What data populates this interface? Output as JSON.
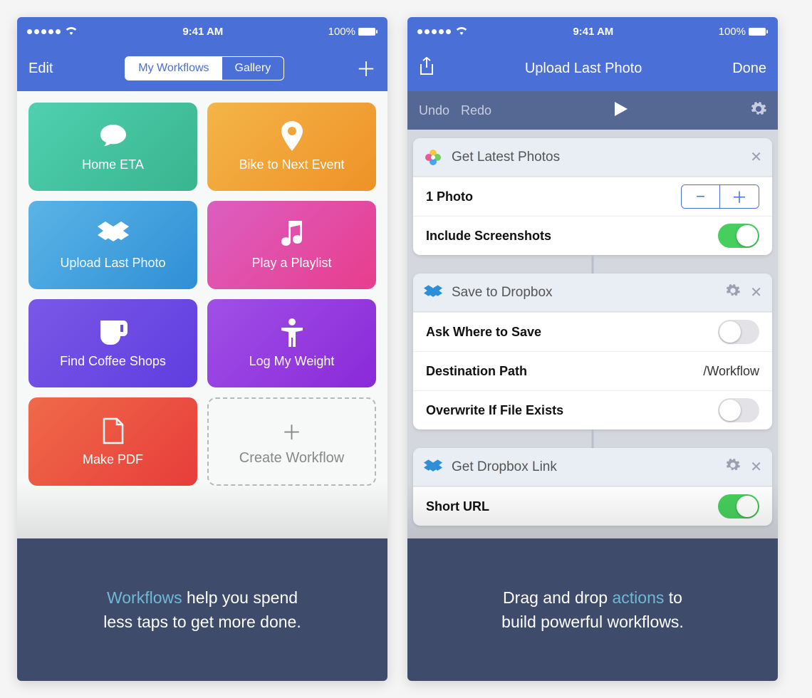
{
  "statusbar": {
    "time": "9:41 AM",
    "battery": "100%"
  },
  "screen1": {
    "nav": {
      "left": "Edit",
      "tabs": [
        "My Workflows",
        "Gallery"
      ],
      "activeTab": 0
    },
    "tiles": [
      {
        "label": "Home ETA"
      },
      {
        "label": "Bike to Next Event"
      },
      {
        "label": "Upload Last Photo"
      },
      {
        "label": "Play a Playlist"
      },
      {
        "label": "Find Coffee Shops"
      },
      {
        "label": "Log My Weight"
      },
      {
        "label": "Make PDF"
      }
    ],
    "create_label": "Create Workflow",
    "caption": {
      "hl": "Workflows",
      "rest1": " help you spend",
      "rest2": "less taps to get more done."
    }
  },
  "screen2": {
    "nav": {
      "title": "Upload Last Photo",
      "right": "Done"
    },
    "toolbar": {
      "undo": "Undo",
      "redo": "Redo"
    },
    "cards": [
      {
        "title": "Get Latest Photos",
        "rows": [
          {
            "label": "1 Photo",
            "type": "stepper"
          },
          {
            "label": "Include Screenshots",
            "type": "switch",
            "on": true
          }
        ]
      },
      {
        "title": "Save to Dropbox",
        "hasSettings": true,
        "rows": [
          {
            "label": "Ask Where to Save",
            "type": "switch",
            "on": false
          },
          {
            "label": "Destination Path",
            "type": "value",
            "value": "/Workflow"
          },
          {
            "label": "Overwrite If File Exists",
            "type": "switch",
            "on": false
          }
        ]
      },
      {
        "title": "Get Dropbox Link",
        "hasSettings": true,
        "rows": [
          {
            "label": "Short URL",
            "type": "switch",
            "on": true
          }
        ]
      }
    ],
    "caption": {
      "pre": "Drag and drop ",
      "hl": "actions",
      "post": " to",
      "line2": "build powerful workflows."
    }
  }
}
